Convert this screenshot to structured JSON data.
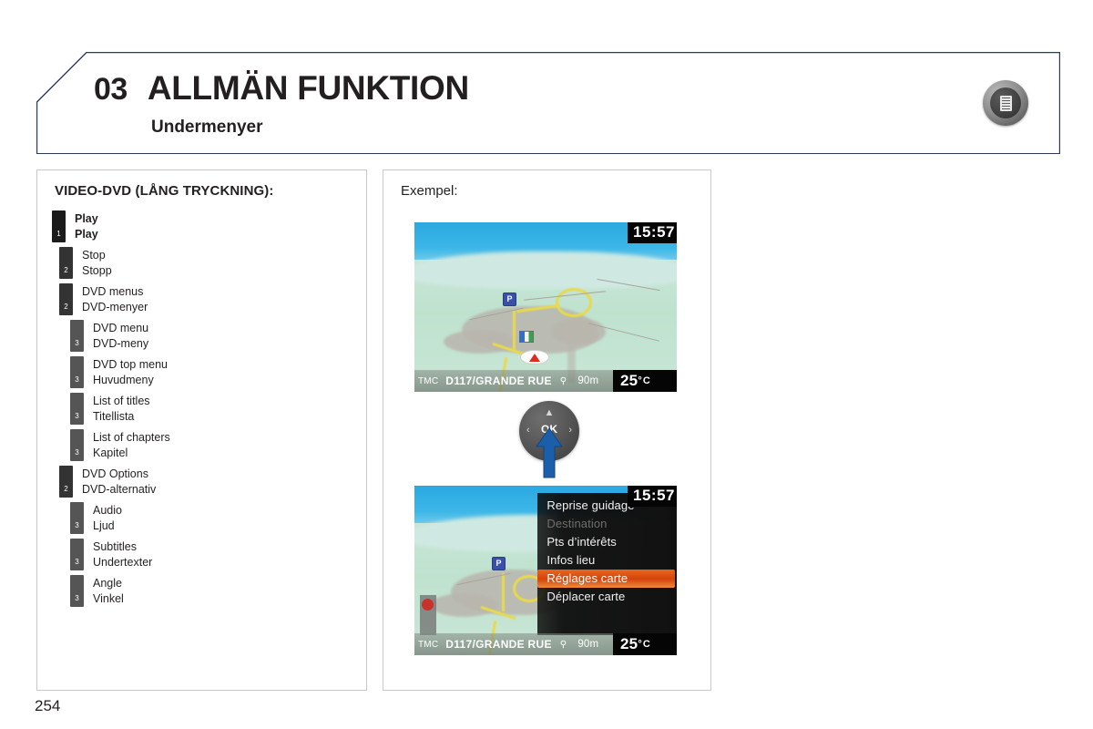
{
  "header": {
    "chapter_number": "03",
    "chapter_title": "ALLMÄN FUNKTION",
    "subtitle": "Undermenyer",
    "icon": "manual-book-icon",
    "border_color": "#2b3a5c"
  },
  "left_panel": {
    "heading": "VIDEO-DVD (LÅNG TRYCKNING):",
    "items": [
      {
        "level": 1,
        "marker": "1",
        "label_en": "Play",
        "label_sv": "Play"
      },
      {
        "level": 2,
        "marker": "2",
        "label_en": "Stop",
        "label_sv": "Stopp"
      },
      {
        "level": 2,
        "marker": "2",
        "label_en": "DVD menus",
        "label_sv": "DVD-menyer"
      },
      {
        "level": 3,
        "marker": "3",
        "label_en": "DVD menu",
        "label_sv": "DVD-meny"
      },
      {
        "level": 3,
        "marker": "3",
        "label_en": "DVD top menu",
        "label_sv": "Huvudmeny"
      },
      {
        "level": 3,
        "marker": "3",
        "label_en": "List of titles",
        "label_sv": "Titellista"
      },
      {
        "level": 3,
        "marker": "3",
        "label_en": "List of chapters",
        "label_sv": "Kapitel"
      },
      {
        "level": 2,
        "marker": "2",
        "label_en": "DVD Options",
        "label_sv": "DVD-alternativ"
      },
      {
        "level": 3,
        "marker": "3",
        "label_en": "Audio",
        "label_sv": "Ljud"
      },
      {
        "level": 3,
        "marker": "3",
        "label_en": "Subtitles",
        "label_sv": "Undertexter"
      },
      {
        "level": 3,
        "marker": "3",
        "label_en": "Angle",
        "label_sv": "Vinkel"
      }
    ]
  },
  "right_panel": {
    "heading": "Exempel:",
    "nav_screen_top": {
      "clock": "15:57",
      "status": {
        "tmc": "TMC",
        "street": "D117/GRANDE RUE",
        "direction_icon": "north-arrow-icon",
        "distance": "90m",
        "temperature": "25",
        "degree_symbol": "°",
        "temperature_unit": "C"
      },
      "poi_parking_label": "P"
    },
    "control_knob": {
      "center_label": "OK",
      "up_icon": "chevron-up-icon",
      "left_icon": "chevron-left-icon",
      "right_icon": "chevron-right-icon",
      "action_arrow_icon": "blue-up-arrow-icon",
      "action_arrow_color": "#1b5faa"
    },
    "nav_screen_bottom": {
      "clock": "15:57",
      "status": {
        "tmc": "TMC",
        "street": "D117/GRANDE RUE",
        "direction_icon": "north-arrow-icon",
        "distance": "90m",
        "temperature": "25",
        "degree_symbol": "°",
        "temperature_unit": "C"
      },
      "poi_parking_label": "P",
      "overlay_menu": {
        "highlight_color": "#d5440c",
        "items": [
          {
            "label": "Reprise guidage",
            "state": "normal"
          },
          {
            "label": "Destination",
            "state": "disabled"
          },
          {
            "label": "Pts d’intérêts",
            "state": "normal"
          },
          {
            "label": "Infos lieu",
            "state": "normal"
          },
          {
            "label": "Réglages carte",
            "state": "selected"
          },
          {
            "label": "Déplacer carte",
            "state": "normal"
          }
        ]
      }
    }
  },
  "footer": {
    "page_number": "254"
  }
}
